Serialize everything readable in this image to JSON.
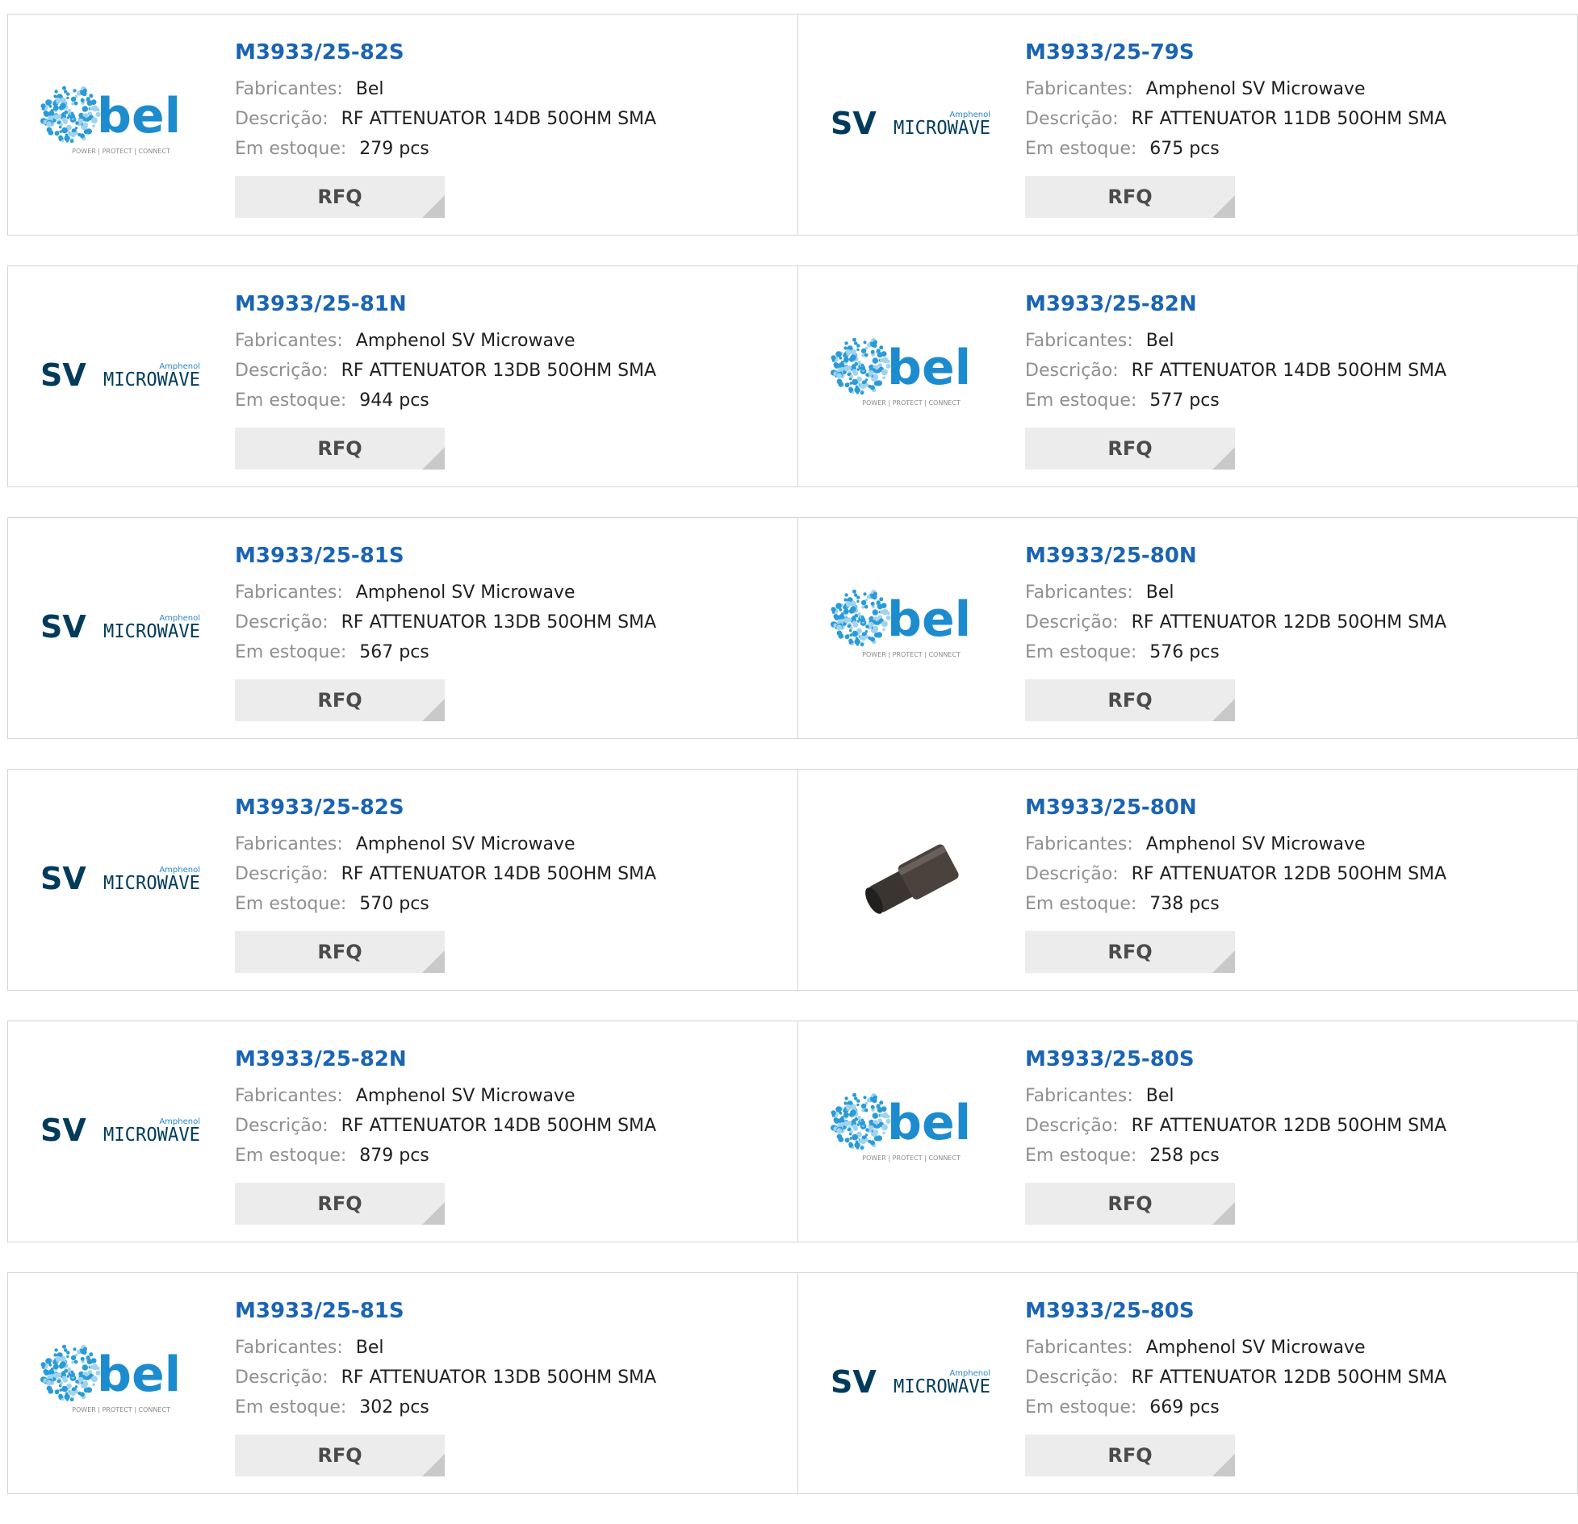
{
  "labels": {
    "manufacturer": "Fabricantes:",
    "description": "Descrição:",
    "stock": "Em estoque:",
    "rfq": "RFQ"
  },
  "logos": {
    "bel": {
      "word": "bel",
      "tagline": "POWER | PROTECT | CONNECT",
      "brand_color": "#1c8ccf"
    },
    "sv": {
      "letters": "SV",
      "word": "MICROWAVE",
      "superscript": "Amphenol",
      "brand_color": "#003b5c"
    }
  },
  "products": [
    {
      "part": "M3933/25-82S",
      "manufacturer": "Bel",
      "description": "RF ATTENUATOR 14DB 50OHM SMA",
      "stock": "279 pcs",
      "image": "bel-logo"
    },
    {
      "part": "M3933/25-79S",
      "manufacturer": "Amphenol SV Microwave",
      "description": "RF ATTENUATOR 11DB 50OHM SMA",
      "stock": "675 pcs",
      "image": "sv-microwave-logo"
    },
    {
      "part": "M3933/25-81N",
      "manufacturer": "Amphenol SV Microwave",
      "description": "RF ATTENUATOR 13DB 50OHM SMA",
      "stock": "944 pcs",
      "image": "sv-microwave-logo"
    },
    {
      "part": "M3933/25-82N",
      "manufacturer": "Bel",
      "description": "RF ATTENUATOR 14DB 50OHM SMA",
      "stock": "577 pcs",
      "image": "bel-logo"
    },
    {
      "part": "M3933/25-81S",
      "manufacturer": "Amphenol SV Microwave",
      "description": "RF ATTENUATOR 13DB 50OHM SMA",
      "stock": "567 pcs",
      "image": "sv-microwave-logo"
    },
    {
      "part": "M3933/25-80N",
      "manufacturer": "Bel",
      "description": "RF ATTENUATOR 12DB 50OHM SMA",
      "stock": "576 pcs",
      "image": "bel-logo"
    },
    {
      "part": "M3933/25-82S",
      "manufacturer": "Amphenol SV Microwave",
      "description": "RF ATTENUATOR 14DB 50OHM SMA",
      "stock": "570 pcs",
      "image": "sv-microwave-logo"
    },
    {
      "part": "M3933/25-80N",
      "manufacturer": "Amphenol SV Microwave",
      "description": "RF ATTENUATOR 12DB 50OHM SMA",
      "stock": "738 pcs",
      "image": "product-photo"
    },
    {
      "part": "M3933/25-82N",
      "manufacturer": "Amphenol SV Microwave",
      "description": "RF ATTENUATOR 14DB 50OHM SMA",
      "stock": "879 pcs",
      "image": "sv-microwave-logo"
    },
    {
      "part": "M3933/25-80S",
      "manufacturer": "Bel",
      "description": "RF ATTENUATOR 12DB 50OHM SMA",
      "stock": "258 pcs",
      "image": "bel-logo"
    },
    {
      "part": "M3933/25-81S",
      "manufacturer": "Bel",
      "description": "RF ATTENUATOR 13DB 50OHM SMA",
      "stock": "302 pcs",
      "image": "bel-logo"
    },
    {
      "part": "M3933/25-80S",
      "manufacturer": "Amphenol SV Microwave",
      "description": "RF ATTENUATOR 12DB 50OHM SMA",
      "stock": "669 pcs",
      "image": "sv-microwave-logo"
    }
  ],
  "colors": {
    "part_link": "#1a64b4",
    "label": "#8f8f8f",
    "value": "#1f1f1f",
    "rfq_bg": "#ececec",
    "border": "#d4d4d4"
  }
}
